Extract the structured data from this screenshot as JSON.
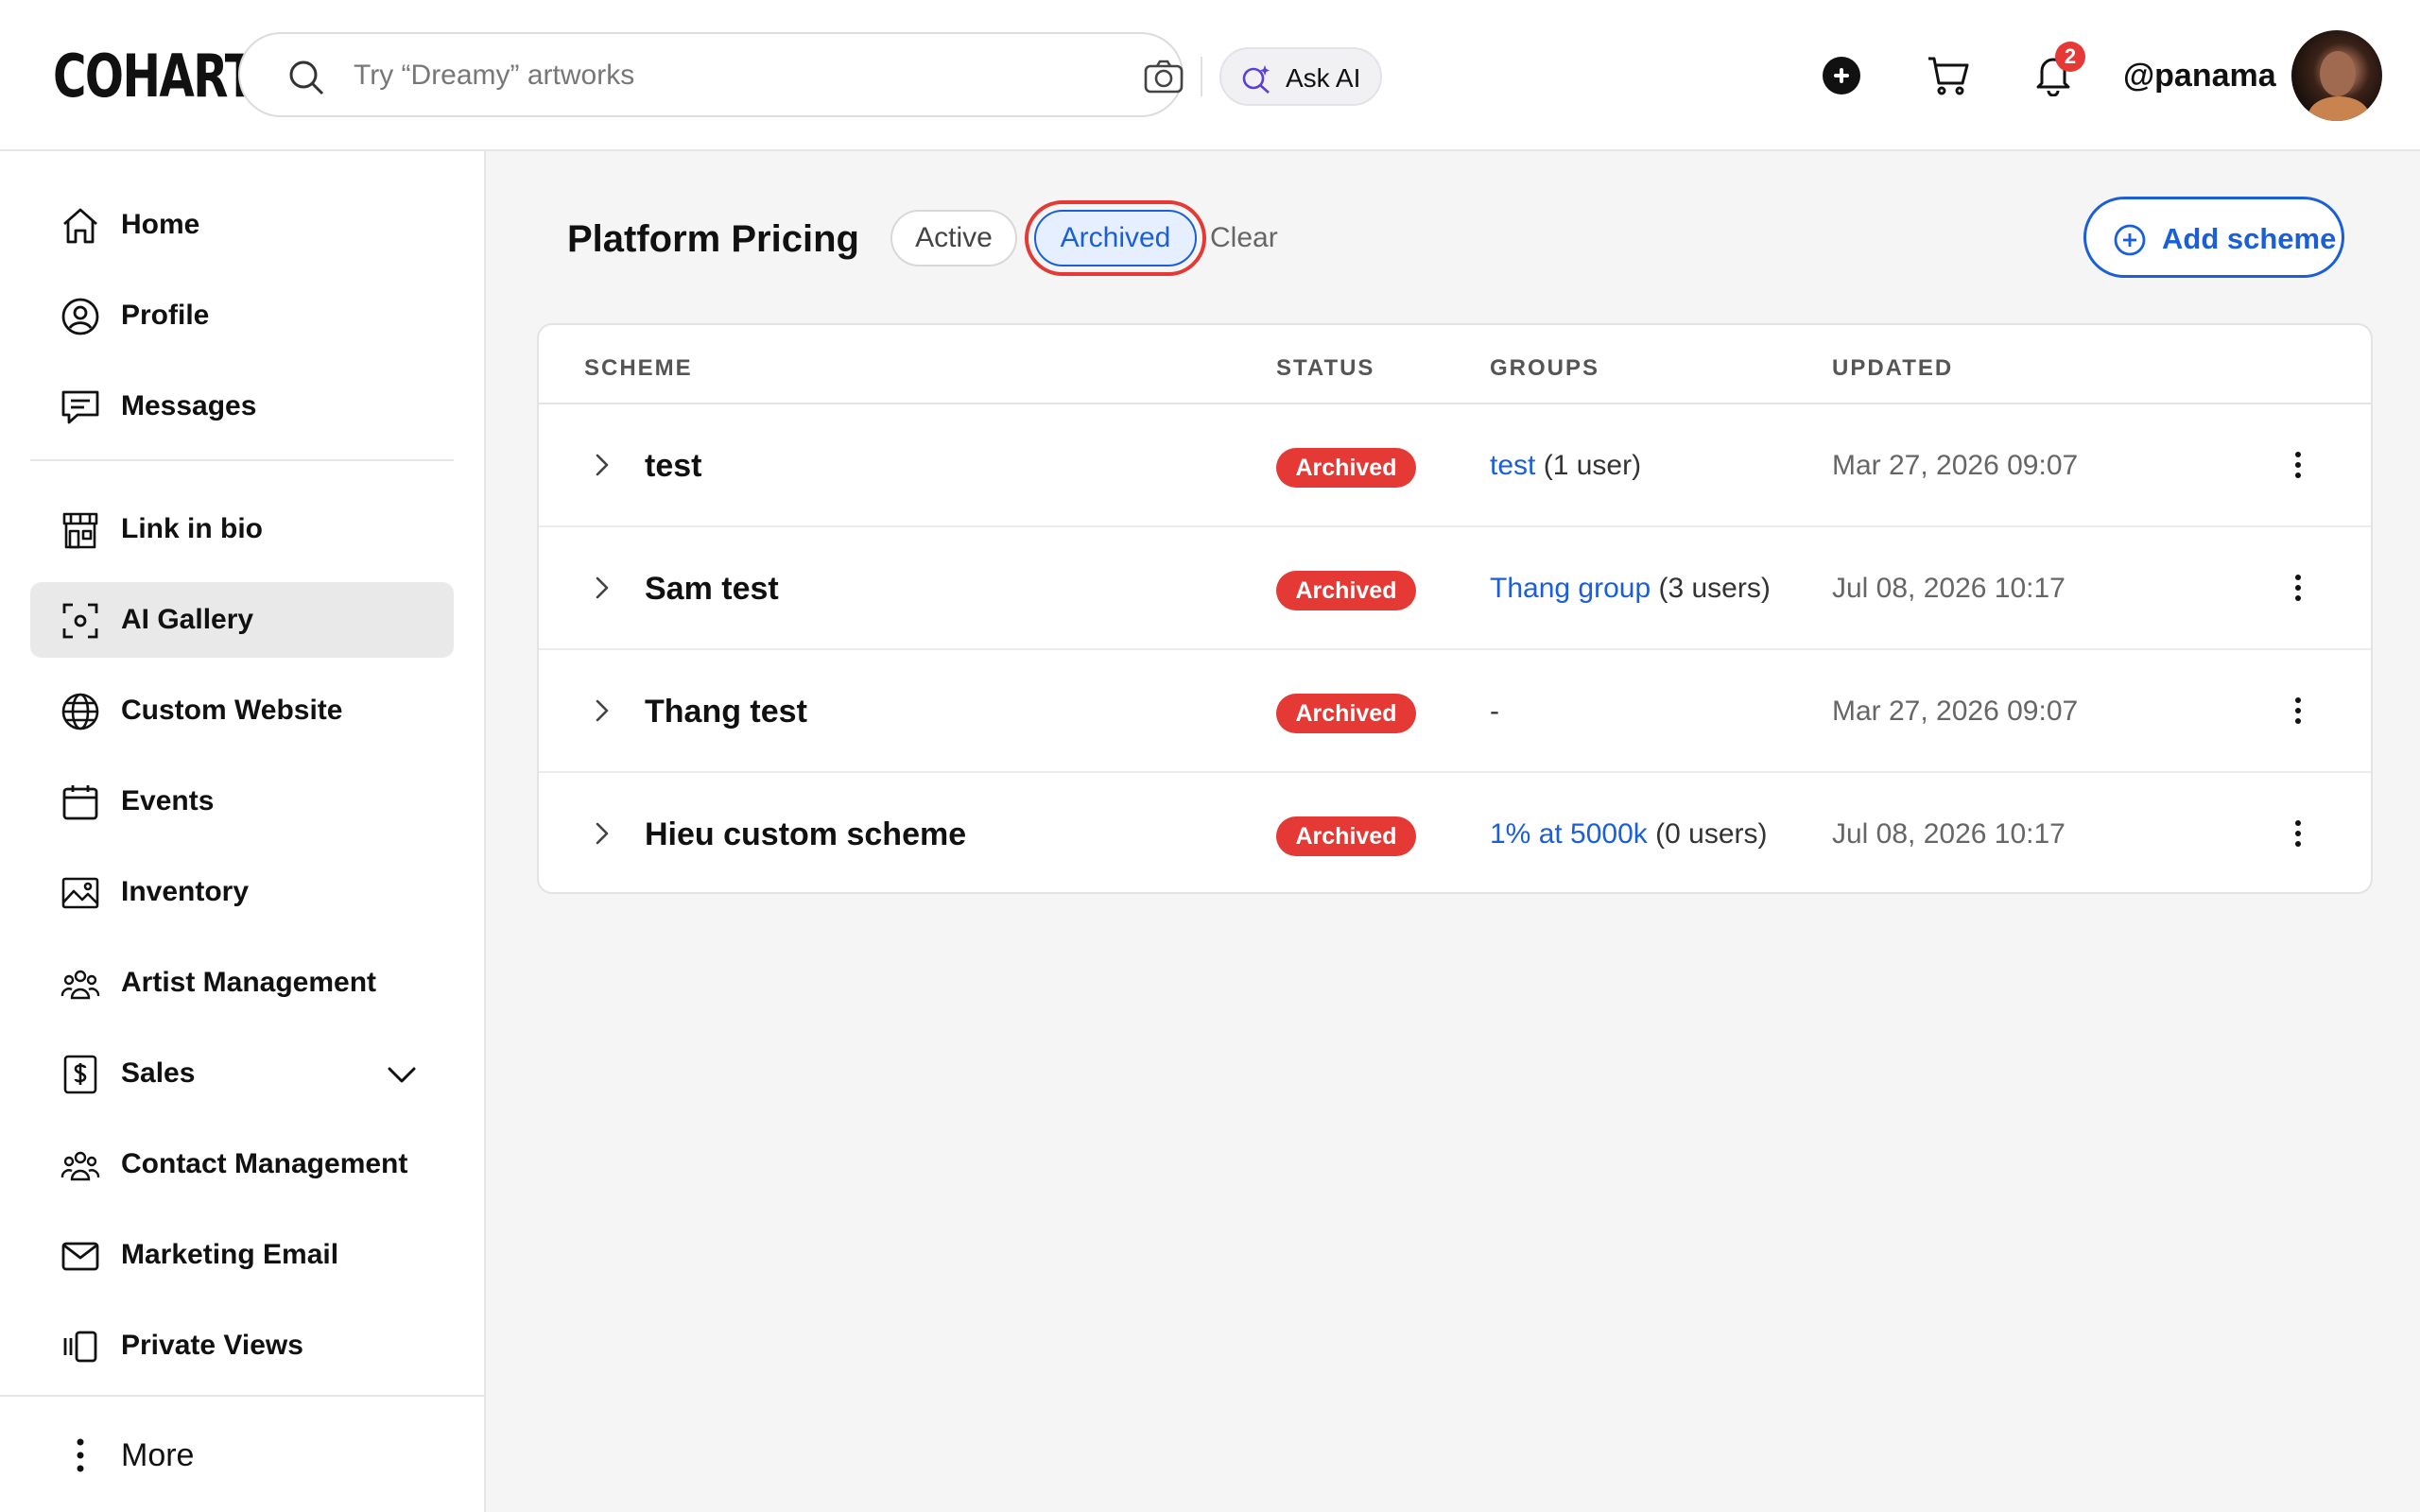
{
  "header": {
    "logo": "COHART",
    "search_placeholder": "Try “Dreamy” artworks",
    "ask_ai_label": "Ask AI",
    "notification_count": "2",
    "username": "@panama"
  },
  "sidebar": {
    "items": [
      {
        "label": "Home",
        "icon": "home-icon"
      },
      {
        "label": "Profile",
        "icon": "profile-icon"
      },
      {
        "label": "Messages",
        "icon": "messages-icon"
      },
      {
        "label": "Link in bio",
        "icon": "storefront-icon"
      },
      {
        "label": "AI Gallery",
        "icon": "ai-scan-icon",
        "active": true
      },
      {
        "label": "Custom Website",
        "icon": "globe-icon"
      },
      {
        "label": "Events",
        "icon": "calendar-icon"
      },
      {
        "label": "Inventory",
        "icon": "image-icon"
      },
      {
        "label": "Artist Management",
        "icon": "people-icon"
      },
      {
        "label": "Sales",
        "icon": "dollar-document-icon"
      },
      {
        "label": "Contact Management",
        "icon": "people-icon"
      },
      {
        "label": "Marketing Email",
        "icon": "envelope-icon"
      },
      {
        "label": "Private Views",
        "icon": "private-views-icon"
      }
    ],
    "more_label": "More"
  },
  "main": {
    "title": "Platform Pricing",
    "filters": {
      "active_label": "Active",
      "archived_label": "Archived",
      "clear_label": "Clear",
      "selected": "Archived"
    },
    "add_scheme_label": "Add scheme",
    "table": {
      "columns": [
        "SCHEME",
        "STATUS",
        "GROUPS",
        "UPDATED"
      ],
      "rows": [
        {
          "scheme": "test",
          "status": "Archived",
          "group_link": "test",
          "group_count": "(1 user)",
          "updated": "Mar 27, 2026 09:07"
        },
        {
          "scheme": "Sam test",
          "status": "Archived",
          "group_link": "Thang group",
          "group_count": "(3 users)",
          "updated": "Jul 08, 2026 10:17"
        },
        {
          "scheme": "Thang test",
          "status": "Archived",
          "group_link": "",
          "group_count": "-",
          "updated": "Mar 27, 2026 09:07"
        },
        {
          "scheme": "Hieu custom scheme",
          "status": "Archived",
          "group_link": "1% at 5000k",
          "group_count": "(0 users)",
          "updated": "Jul 08, 2026 10:17"
        }
      ]
    }
  },
  "colors": {
    "accent": "#1a5fd8",
    "archived_badge": "#e53935",
    "highlight_ring": "#e53935"
  }
}
